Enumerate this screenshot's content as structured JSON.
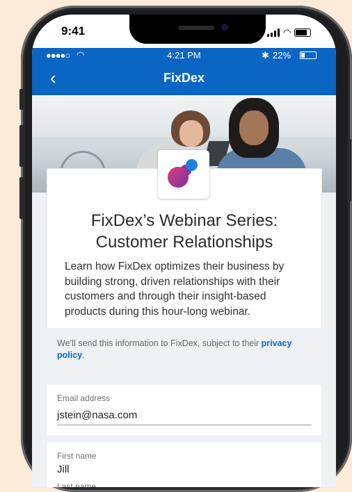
{
  "device": {
    "ios_time": "9:41"
  },
  "app_status": {
    "dots": "●●●●○",
    "time": "4:21 PM",
    "bluetooth": "✱",
    "battery_pct": "22%"
  },
  "nav": {
    "back_symbol": "‹",
    "title": "FixDex"
  },
  "webinar": {
    "title_line1": "FixDex’s Webinar Series:",
    "title_line2": "Customer Relationships",
    "description": "Learn how FixDex optimizes their business by building strong, driven relationships with their customers and through their insight-based products during this hour-long webinar."
  },
  "disclaimer": {
    "text": "We’ll send this information to FixDex, subject to their ",
    "link": "privacy policy",
    "end": "."
  },
  "form": {
    "email_label": "Email address",
    "email_value": "jstein@nasa.com",
    "first_name_label": "First name",
    "first_name_value": "Jill",
    "last_name_label": "Last name"
  },
  "colors": {
    "brand_blue": "#0a66c2",
    "background": "#fcebd8"
  }
}
